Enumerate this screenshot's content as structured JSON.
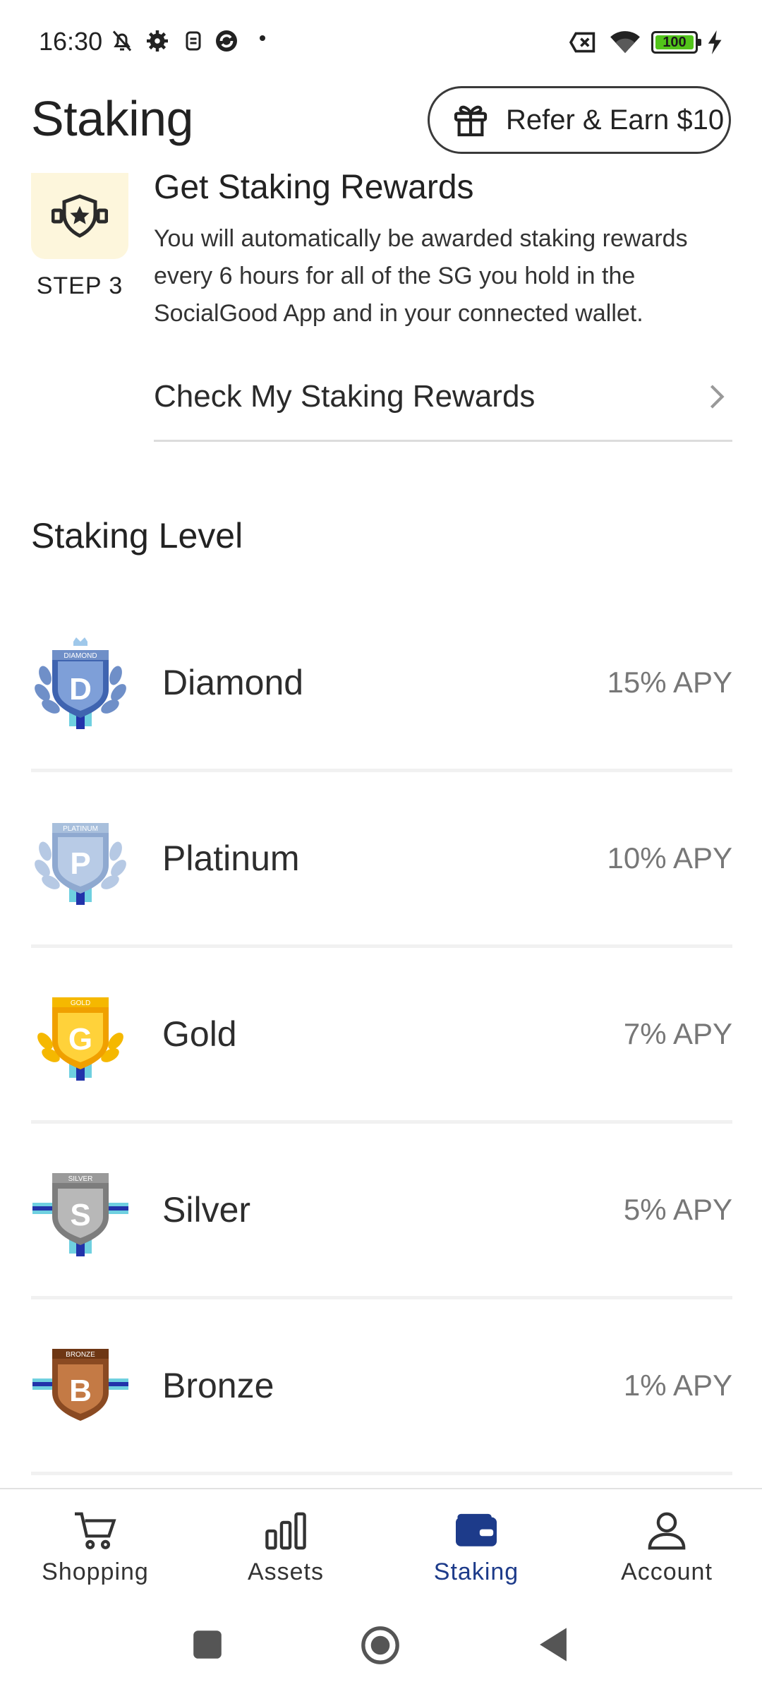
{
  "status_bar": {
    "time": "16:30",
    "battery": "100"
  },
  "header": {
    "title": "Staking",
    "refer_label": "Refer & Earn $10"
  },
  "step": {
    "label": "STEP 3",
    "title": "Get Staking Rewards",
    "description": "You will automatically be awarded staking rewards every 6 hours for all of the SG you hold in the SocialGood App and in your connected wallet.",
    "link_label": "Check My Staking Rewards"
  },
  "staking_level": {
    "title": "Staking Level",
    "levels": [
      {
        "name": "Diamond",
        "apy": "15% APY",
        "badge_letter": "D",
        "badge_text": "DIAMOND",
        "color": "#6f8fc8"
      },
      {
        "name": "Platinum",
        "apy": "10% APY",
        "badge_letter": "P",
        "badge_text": "PLATINUM",
        "color": "#a8bfdc"
      },
      {
        "name": "Gold",
        "apy": "7% APY",
        "badge_letter": "G",
        "badge_text": "GOLD",
        "color": "#f5b800"
      },
      {
        "name": "Silver",
        "apy": "5% APY",
        "badge_letter": "S",
        "badge_text": "SILVER",
        "color": "#9a9a9a"
      },
      {
        "name": "Bronze",
        "apy": "1% APY",
        "badge_letter": "B",
        "badge_text": "BRONZE",
        "color": "#a0552a"
      }
    ]
  },
  "bottom_nav": {
    "items": [
      {
        "label": "Shopping",
        "icon": "cart-icon"
      },
      {
        "label": "Assets",
        "icon": "bar-chart-icon"
      },
      {
        "label": "Staking",
        "icon": "wallet-icon",
        "active": true
      },
      {
        "label": "Account",
        "icon": "person-icon"
      }
    ]
  },
  "colors": {
    "accent": "#1d3b8a",
    "step_bg": "#fdf6dc"
  }
}
